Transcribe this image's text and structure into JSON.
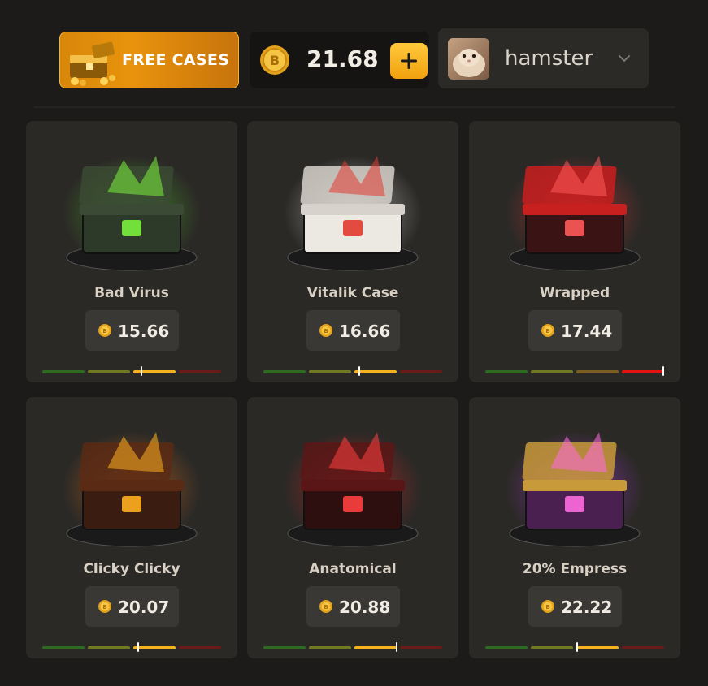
{
  "header": {
    "free_cases_label": "FREE CASES",
    "balance": "21.68",
    "add_funds_icon": "plus-icon",
    "username": "hamster",
    "menu_icon": "chevron-down-icon"
  },
  "colors": {
    "accent": "#f5b21c",
    "card_bg": "#2b2926",
    "meter_green": "#2e7a25",
    "meter_olive": "#7c8a24",
    "meter_amber": "#b08a2a",
    "meter_red": "#e3140f"
  },
  "cases": [
    {
      "name": "Bad Virus",
      "price": "15.66",
      "theme": "green",
      "risk_level": 0.55
    },
    {
      "name": "Vitalik Case",
      "price": "16.66",
      "theme": "paint",
      "risk_level": 0.53
    },
    {
      "name": "Wrapped",
      "price": "17.44",
      "theme": "red",
      "risk_level": 0.99
    },
    {
      "name": "Clicky Clicky",
      "price": "20.07",
      "theme": "fire",
      "risk_level": 0.53
    },
    {
      "name": "Anatomical",
      "price": "20.88",
      "theme": "crimson",
      "risk_level": 0.74
    },
    {
      "name": "20% Empress",
      "price": "22.22",
      "theme": "purple",
      "risk_level": 0.51
    }
  ]
}
